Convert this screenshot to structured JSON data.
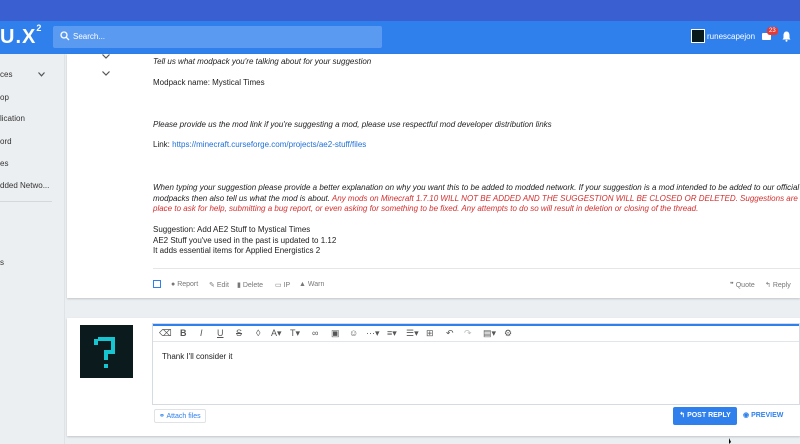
{
  "header": {
    "logo_text": "U.X",
    "logo_sup": "2",
    "search_placeholder": "Search...",
    "username": "runescapejon",
    "notif_count": "23"
  },
  "sidebar": {
    "items": [
      "ces",
      "op",
      "lication",
      "ord",
      "es",
      "dded Netwo...",
      "s"
    ]
  },
  "post": {
    "q1": "Tell us what modpack you're talking about for your suggestion",
    "modpack": "Modpack name: Mystical Times",
    "q2": "Please provide us the mod link if you're suggesting a mod, please use respectful mod developer distribution links",
    "link_label": "Link: ",
    "link_url": "https://minecraft.curseforge.com/projects/ae2-stuff/files",
    "q3_line1_a": "When typing your suggestion please provide a better explanation on why you want this to be added to modded network. If your suggestion is a mod intended to be added to our official",
    "q3_line2_a": "modpacks then also tell us what the mod is about.",
    "q3_line2_b": " Any mods on Minecraft 1.7.10 WILL NOT BE ADDED AND THE SUGGESTION WILL BE CLOSED OR DELETED. Suggestions are NOT a",
    "q3_line3": "place to ask for help, submitting a bug report, or even asking for something to be fixed. Any attempts to do so will result in deletion or closing of the thread.",
    "s1": "Suggestion: Add AE2 Stuff to Mystical Times",
    "s2": "AE2 Stuff you've used in the past is updated to 1.12",
    "s3": "It adds essential items for Applied Energistics 2",
    "actions": {
      "report": "Report",
      "edit": "Edit",
      "delete": "Delete",
      "ip": "IP",
      "warn": "Warn",
      "quote": "Quote",
      "reply": "Reply"
    }
  },
  "reply": {
    "editor_text": "Thank I'll consider it",
    "attach_label": "Attach files",
    "post_reply_label": "POST REPLY",
    "preview_label": "PREVIEW"
  },
  "colors": {
    "accent": "#2f80ed",
    "warning_red": "#d32f2f"
  }
}
